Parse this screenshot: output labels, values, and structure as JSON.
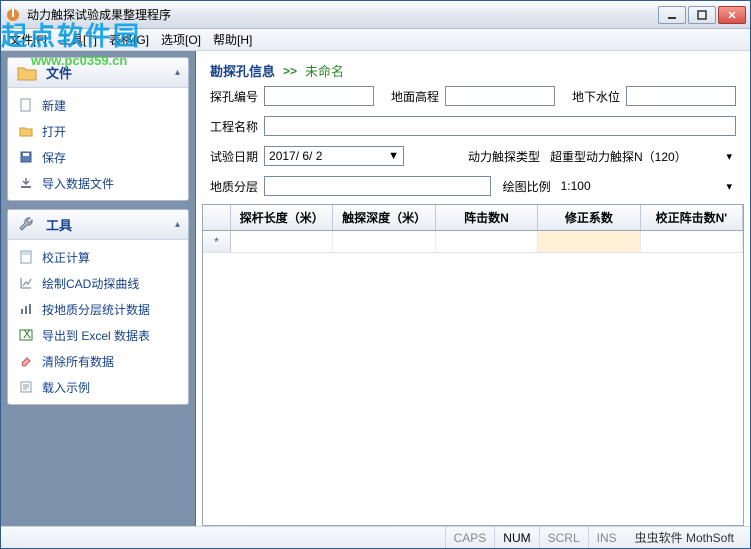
{
  "window": {
    "title": "动力触探试验成果整理程序"
  },
  "menubar": {
    "file": "文件[F]",
    "tool": "工具[T]",
    "table": "表格[G]",
    "option": "选项[O]",
    "help": "帮助[H]"
  },
  "watermark": {
    "logo": "起点软件园",
    "url": "www.pc0359.cn"
  },
  "sidebar": {
    "file": {
      "title": "文件",
      "items": [
        {
          "label": "新建"
        },
        {
          "label": "打开"
        },
        {
          "label": "保存"
        },
        {
          "label": "导入数据文件"
        }
      ]
    },
    "tool": {
      "title": "工具",
      "items": [
        {
          "label": "校正计算"
        },
        {
          "label": "绘制CAD动探曲线"
        },
        {
          "label": "按地质分层统计数据"
        },
        {
          "label": "导出到 Excel 数据表"
        },
        {
          "label": "清除所有数据"
        },
        {
          "label": "载入示例"
        }
      ]
    }
  },
  "section": {
    "label": "勘探孔信息",
    "name": "未命名"
  },
  "form": {
    "hole_no_label": "探孔编号",
    "hole_no": "",
    "ground_elev_label": "地面高程",
    "ground_elev": "",
    "water_level_label": "地下水位",
    "water_level": "",
    "project_label": "工程名称",
    "project": "",
    "date_label": "试验日期",
    "date": "2017/ 6/ 2",
    "probe_type_label": "动力触探类型",
    "probe_type": "超重型动力触探N（120）",
    "stratum_label": "地质分层",
    "stratum": "",
    "scale_label": "绘图比例",
    "scale": "1:100"
  },
  "grid": {
    "cols": [
      "探杆长度（米）",
      "触探深度（米）",
      "阵击数N",
      "修正系数",
      "校正阵击数N'"
    ]
  },
  "status": {
    "caps": "CAPS",
    "num": "NUM",
    "scrl": "SCRL",
    "ins": "INS",
    "brand": "虫虫软件 MothSoft"
  }
}
